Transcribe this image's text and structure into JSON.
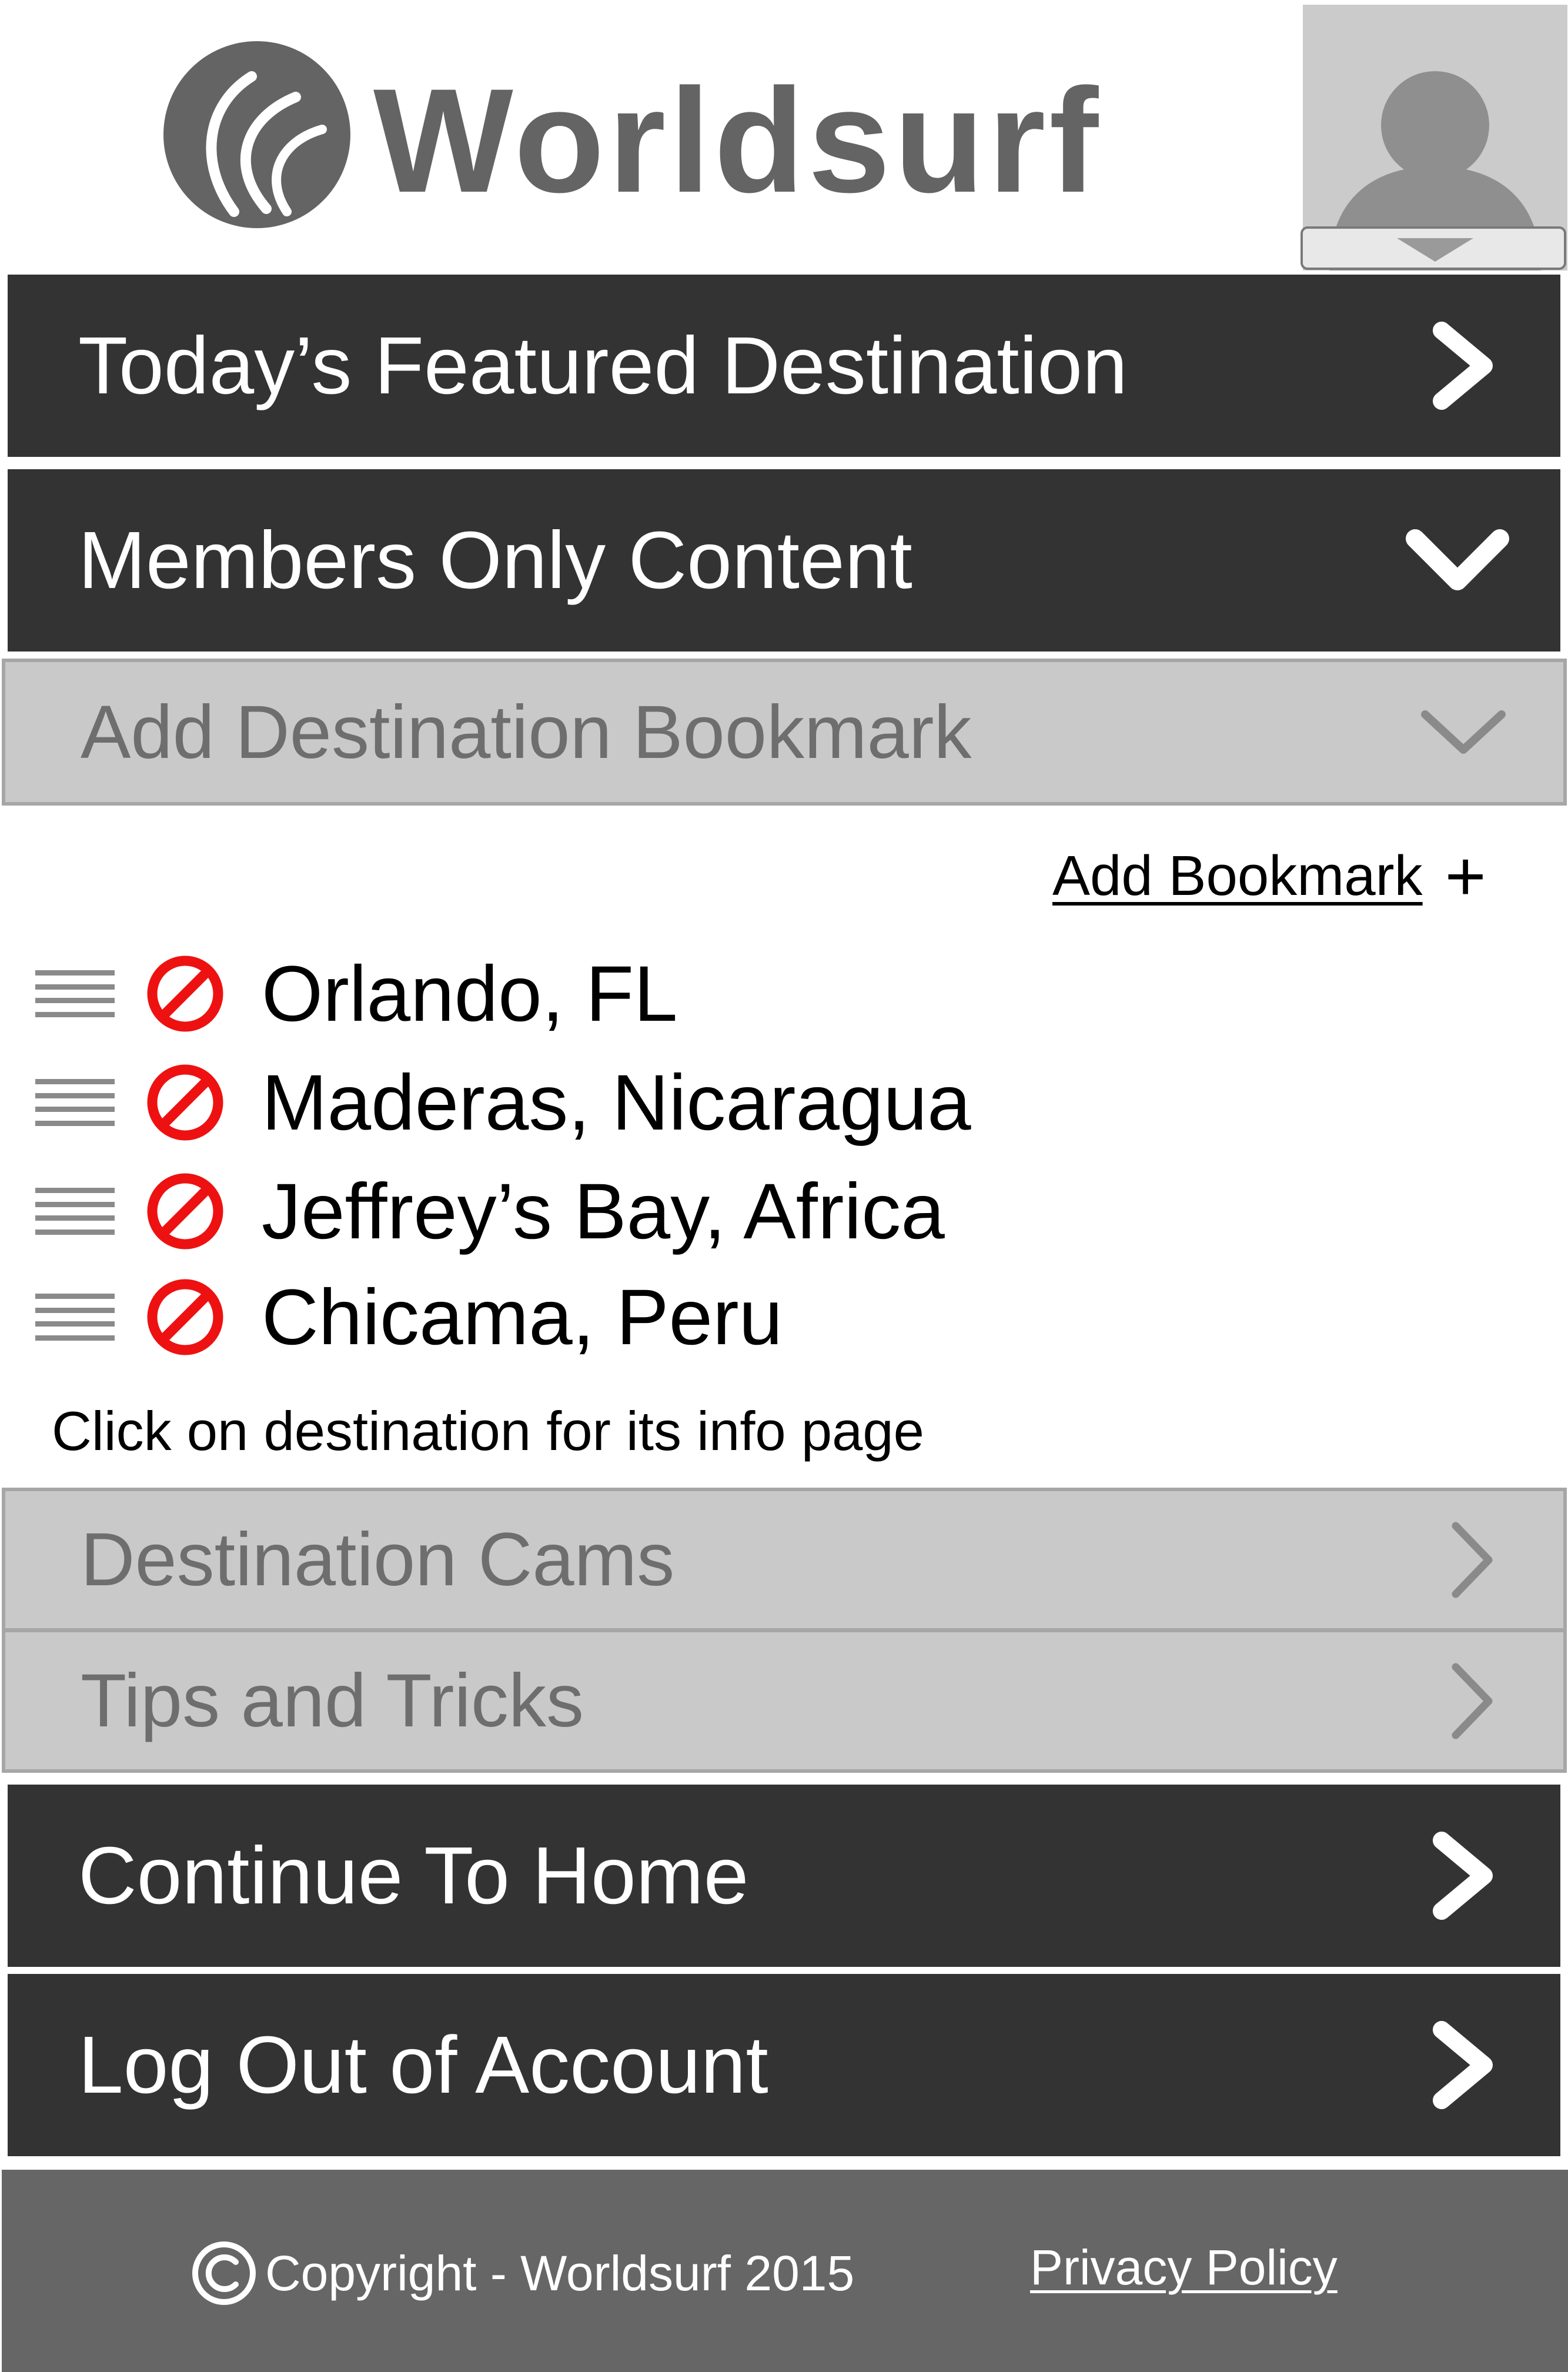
{
  "app": {
    "brand": "Worldsurf"
  },
  "header": {
    "logo_icon": "worldsurf-logo-icon",
    "avatar_icon": "user-avatar-icon",
    "avatar_menu_icon": "chevron-down-icon"
  },
  "menu": {
    "featured": {
      "label": "Today’s Featured Destination",
      "icon": "chevron-right-icon"
    },
    "members": {
      "label": "Members Only Content",
      "icon": "chevron-down-icon"
    },
    "add_destination_bookmark": {
      "label": "Add Destination Bookmark",
      "icon": "chevron-down-icon"
    },
    "destination_cams": {
      "label": "Destination Cams",
      "icon": "chevron-right-icon"
    },
    "tips_and_tricks": {
      "label": "Tips and Tricks",
      "icon": "chevron-right-icon"
    },
    "continue_home": {
      "label": "Continue To Home",
      "icon": "chevron-right-icon"
    },
    "log_out": {
      "label": "Log Out of Account",
      "icon": "chevron-right-icon"
    }
  },
  "bookmarks": {
    "add_label": "Add Bookmark",
    "add_icon": "+",
    "items": [
      {
        "name": "Orlando, FL"
      },
      {
        "name": "Maderas, Nicaragua"
      },
      {
        "name": "Jeffrey’s Bay, Africa"
      },
      {
        "name": "Chicama, Peru"
      }
    ],
    "hint": "Click on destination for its info page"
  },
  "footer": {
    "copyright": "Copyright - Worldsurf 2015",
    "privacy_link": "Privacy Policy"
  },
  "colors": {
    "dark_bar": "#333333",
    "light_bar": "#c9c9c9",
    "delete_red": "#ee1111",
    "footer": "#666666"
  }
}
